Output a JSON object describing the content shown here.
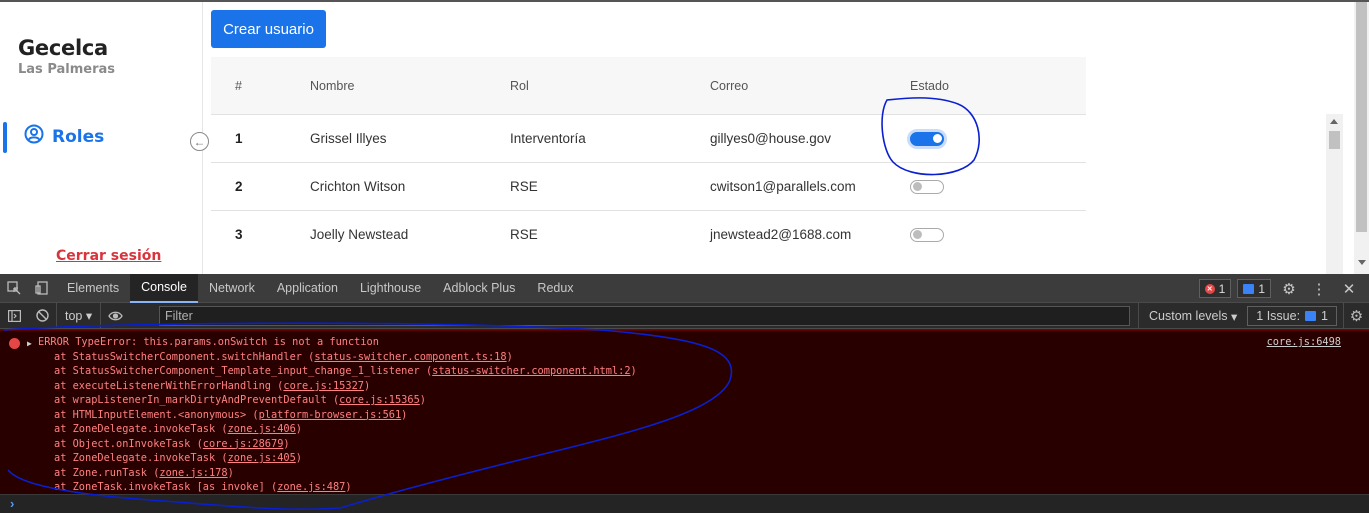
{
  "brand": {
    "title": "Gecelca",
    "subtitle": "Las Palmeras"
  },
  "nav": {
    "roles_label": "Roles",
    "logout_label": "Cerrar sesión"
  },
  "actions": {
    "create_user_label": "Crear usuario"
  },
  "table": {
    "headers": [
      "#",
      "Nombre",
      "Rol",
      "Correo",
      "Estado"
    ],
    "rows": [
      {
        "num": "1",
        "name": "Grissel Illyes",
        "role": "Interventoría",
        "email": "gillyes0@house.gov",
        "active": true
      },
      {
        "num": "2",
        "name": "Crichton Witson",
        "role": "RSE",
        "email": "cwitson1@parallels.com",
        "active": false
      },
      {
        "num": "3",
        "name": "Joelly Newstead",
        "role": "RSE",
        "email": "jnewstead2@1688.com",
        "active": false
      }
    ]
  },
  "devtools": {
    "tabs": [
      "Elements",
      "Console",
      "Network",
      "Application",
      "Lighthouse",
      "Adblock Plus",
      "Redux"
    ],
    "active_tab": "Console",
    "error_count": "1",
    "message_count": "1",
    "context": "top",
    "filter_placeholder": "Filter",
    "levels_label": "Custom levels",
    "issues_label": "1 Issue:",
    "issues_count": "1",
    "error": {
      "message": "ERROR TypeError: this.params.onSwitch is not a function",
      "source": "core.js:6498",
      "frames": [
        {
          "text": "at StatusSwitcherComponent.switchHandler (",
          "link": "status-switcher.component.ts:18",
          "tail": ")"
        },
        {
          "text": "at StatusSwitcherComponent_Template_input_change_1_listener (",
          "link": "status-switcher.component.html:2",
          "tail": ")"
        },
        {
          "text": "at executeListenerWithErrorHandling (",
          "link": "core.js:15327",
          "tail": ")"
        },
        {
          "text": "at wrapListenerIn_markDirtyAndPreventDefault (",
          "link": "core.js:15365",
          "tail": ")"
        },
        {
          "text": "at HTMLInputElement.<anonymous> (",
          "link": "platform-browser.js:561",
          "tail": ")"
        },
        {
          "text": "at ZoneDelegate.invokeTask (",
          "link": "zone.js:406",
          "tail": ")"
        },
        {
          "text": "at Object.onInvokeTask (",
          "link": "core.js:28679",
          "tail": ")"
        },
        {
          "text": "at ZoneDelegate.invokeTask (",
          "link": "zone.js:405",
          "tail": ")"
        },
        {
          "text": "at Zone.runTask (",
          "link": "zone.js:178",
          "tail": ")"
        },
        {
          "text": "at ZoneTask.invokeTask [as invoke] (",
          "link": "zone.js:487",
          "tail": ")"
        }
      ]
    }
  },
  "colors": {
    "accent": "#1a73e8",
    "logout": "#d9343c",
    "error_bg": "#290000",
    "annotation": "#0a1fd0"
  }
}
